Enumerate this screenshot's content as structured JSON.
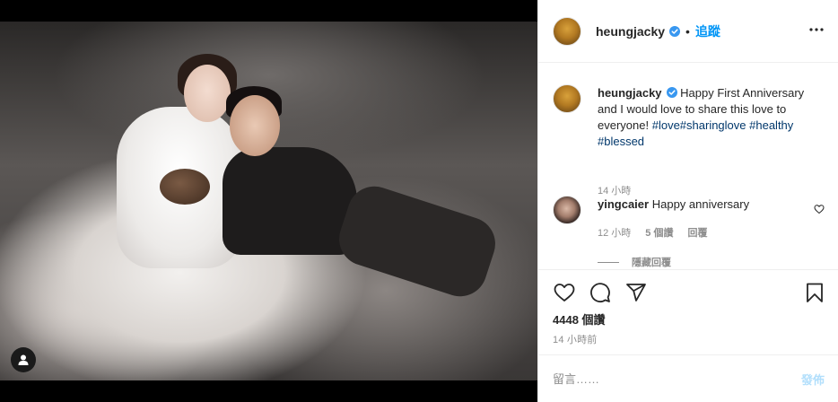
{
  "post": {
    "username": "heungjacky",
    "follow_label": "追蹤",
    "dot": "•",
    "caption": {
      "username": "heungjacky",
      "text": "Happy First Anniversary and I would love to share this love to everyone!",
      "tags": [
        "#love",
        "#sharinglove",
        "#healthy",
        "#blessed"
      ],
      "time": "14 小時"
    },
    "comment": {
      "username": "yingcaier",
      "text": "Happy anniversary",
      "time": "12 小時",
      "likes": "5 個讚",
      "reply_label": "回覆",
      "hide_replies_label": "隱藏回覆"
    },
    "views": "4448 個讚",
    "posted_ago": "14 小時前",
    "add_comment_placeholder": "留言……",
    "post_label": "發佈"
  },
  "colors": {
    "accent": "#0095f6",
    "hashtag": "#00376b",
    "muted": "#8e8e8e",
    "post_disabled": "#b2dffc",
    "verified": "#3897f0"
  },
  "icons": [
    "user-tag-icon",
    "verified-badge-icon",
    "more-options-icon",
    "heart-icon",
    "comment-icon",
    "share-icon",
    "bookmark-icon",
    "small-heart-icon"
  ]
}
